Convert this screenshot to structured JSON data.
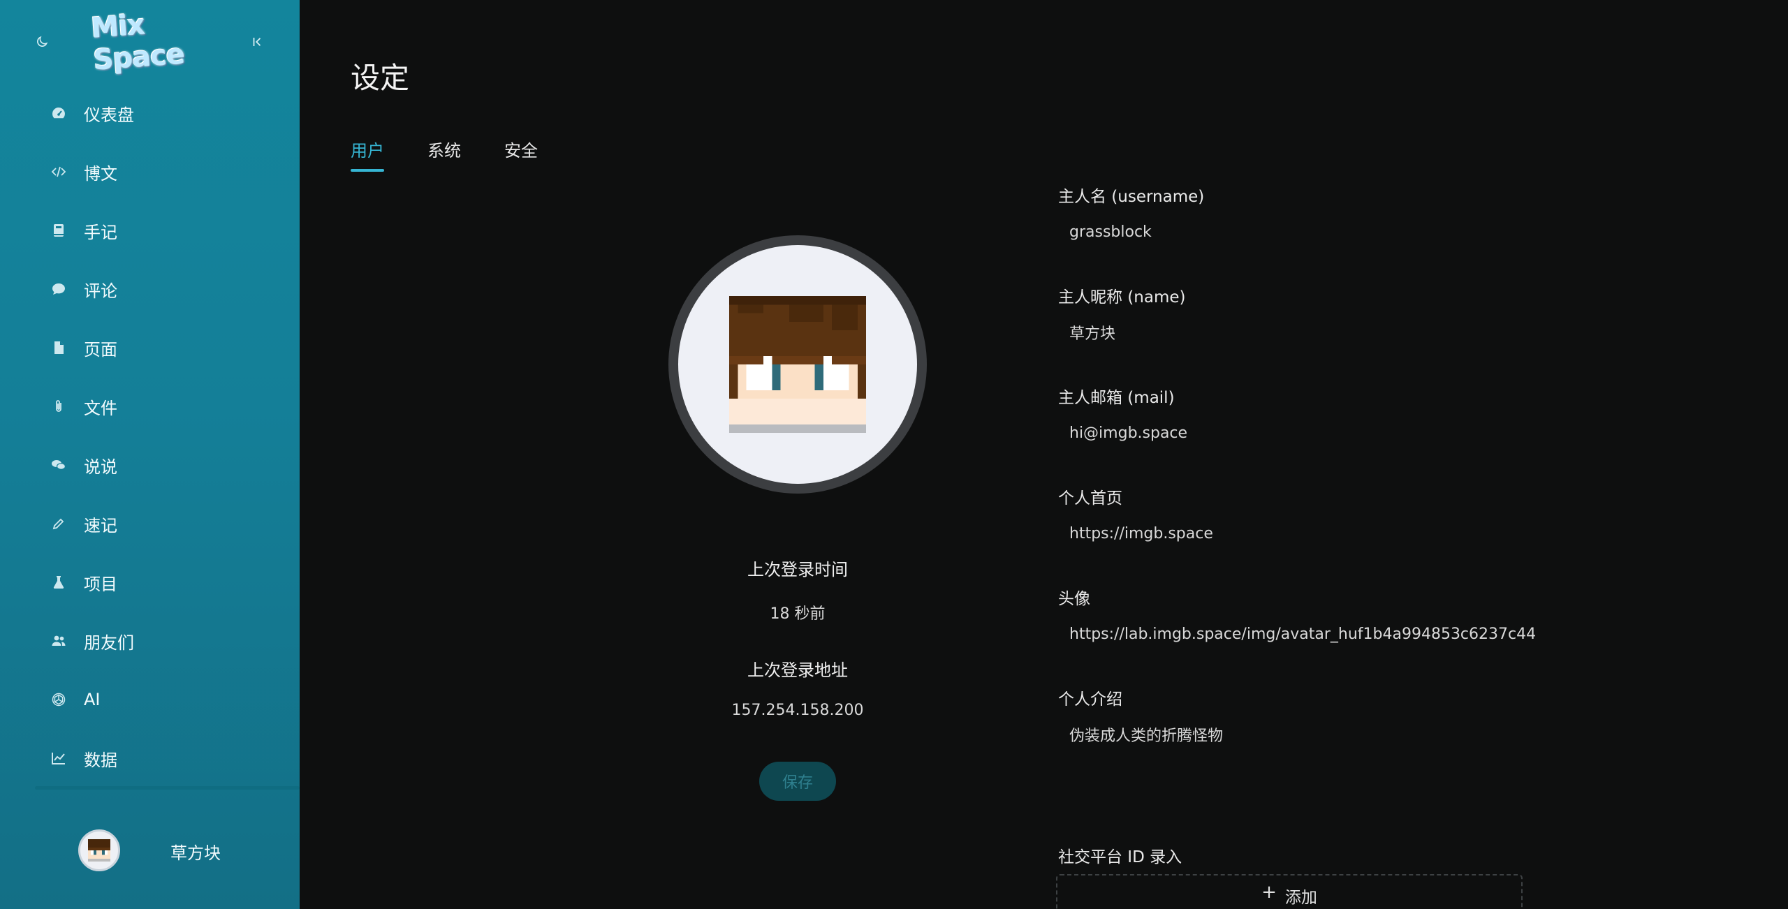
{
  "sidebar": {
    "logo_text": "Mix Space",
    "items": [
      {
        "label": "仪表盘",
        "icon": "dashboard-icon"
      },
      {
        "label": "博文",
        "icon": "code-icon"
      },
      {
        "label": "手记",
        "icon": "book-icon"
      },
      {
        "label": "评论",
        "icon": "comment-icon"
      },
      {
        "label": "页面",
        "icon": "file-icon"
      },
      {
        "label": "文件",
        "icon": "paperclip-icon"
      },
      {
        "label": "说说",
        "icon": "chat-icon"
      },
      {
        "label": "速记",
        "icon": "pencil-icon"
      },
      {
        "label": "项目",
        "icon": "flask-icon"
      },
      {
        "label": "朋友们",
        "icon": "friends-icon"
      },
      {
        "label": "AI",
        "icon": "openai-icon"
      },
      {
        "label": "数据",
        "icon": "chart-icon"
      }
    ],
    "user": {
      "name": "草方块"
    }
  },
  "main": {
    "title": "设定",
    "tabs": [
      {
        "label": "用户",
        "active": true
      },
      {
        "label": "系统",
        "active": false
      },
      {
        "label": "安全",
        "active": false
      }
    ],
    "last_login": {
      "time_label": "上次登录时间",
      "time_value": "18 秒前",
      "ip_label": "上次登录地址",
      "ip_value": "157.254.158.200"
    },
    "save_label": "保存",
    "form": {
      "username": {
        "label": "主人名 (username)",
        "value": "grassblock"
      },
      "name": {
        "label": "主人昵称 (name)",
        "value": "草方块"
      },
      "mail": {
        "label": "主人邮箱 (mail)",
        "value": "hi@imgb.space"
      },
      "homepage": {
        "label": "个人首页",
        "value": "https://imgb.space"
      },
      "avatar": {
        "label": "头像",
        "value": "https://lab.imgb.space/img/avatar_huf1b4a994853c6237c44"
      },
      "intro": {
        "label": "个人介绍",
        "value": "伪装成人类的折腾怪物"
      }
    },
    "social": {
      "label": "社交平台 ID 录入",
      "add_label": "添加"
    }
  },
  "colors": {
    "sidebar_bg": "#13859c",
    "accent": "#36b5d3",
    "main_bg": "#0e0f0f",
    "save_bg": "#0e4750"
  }
}
